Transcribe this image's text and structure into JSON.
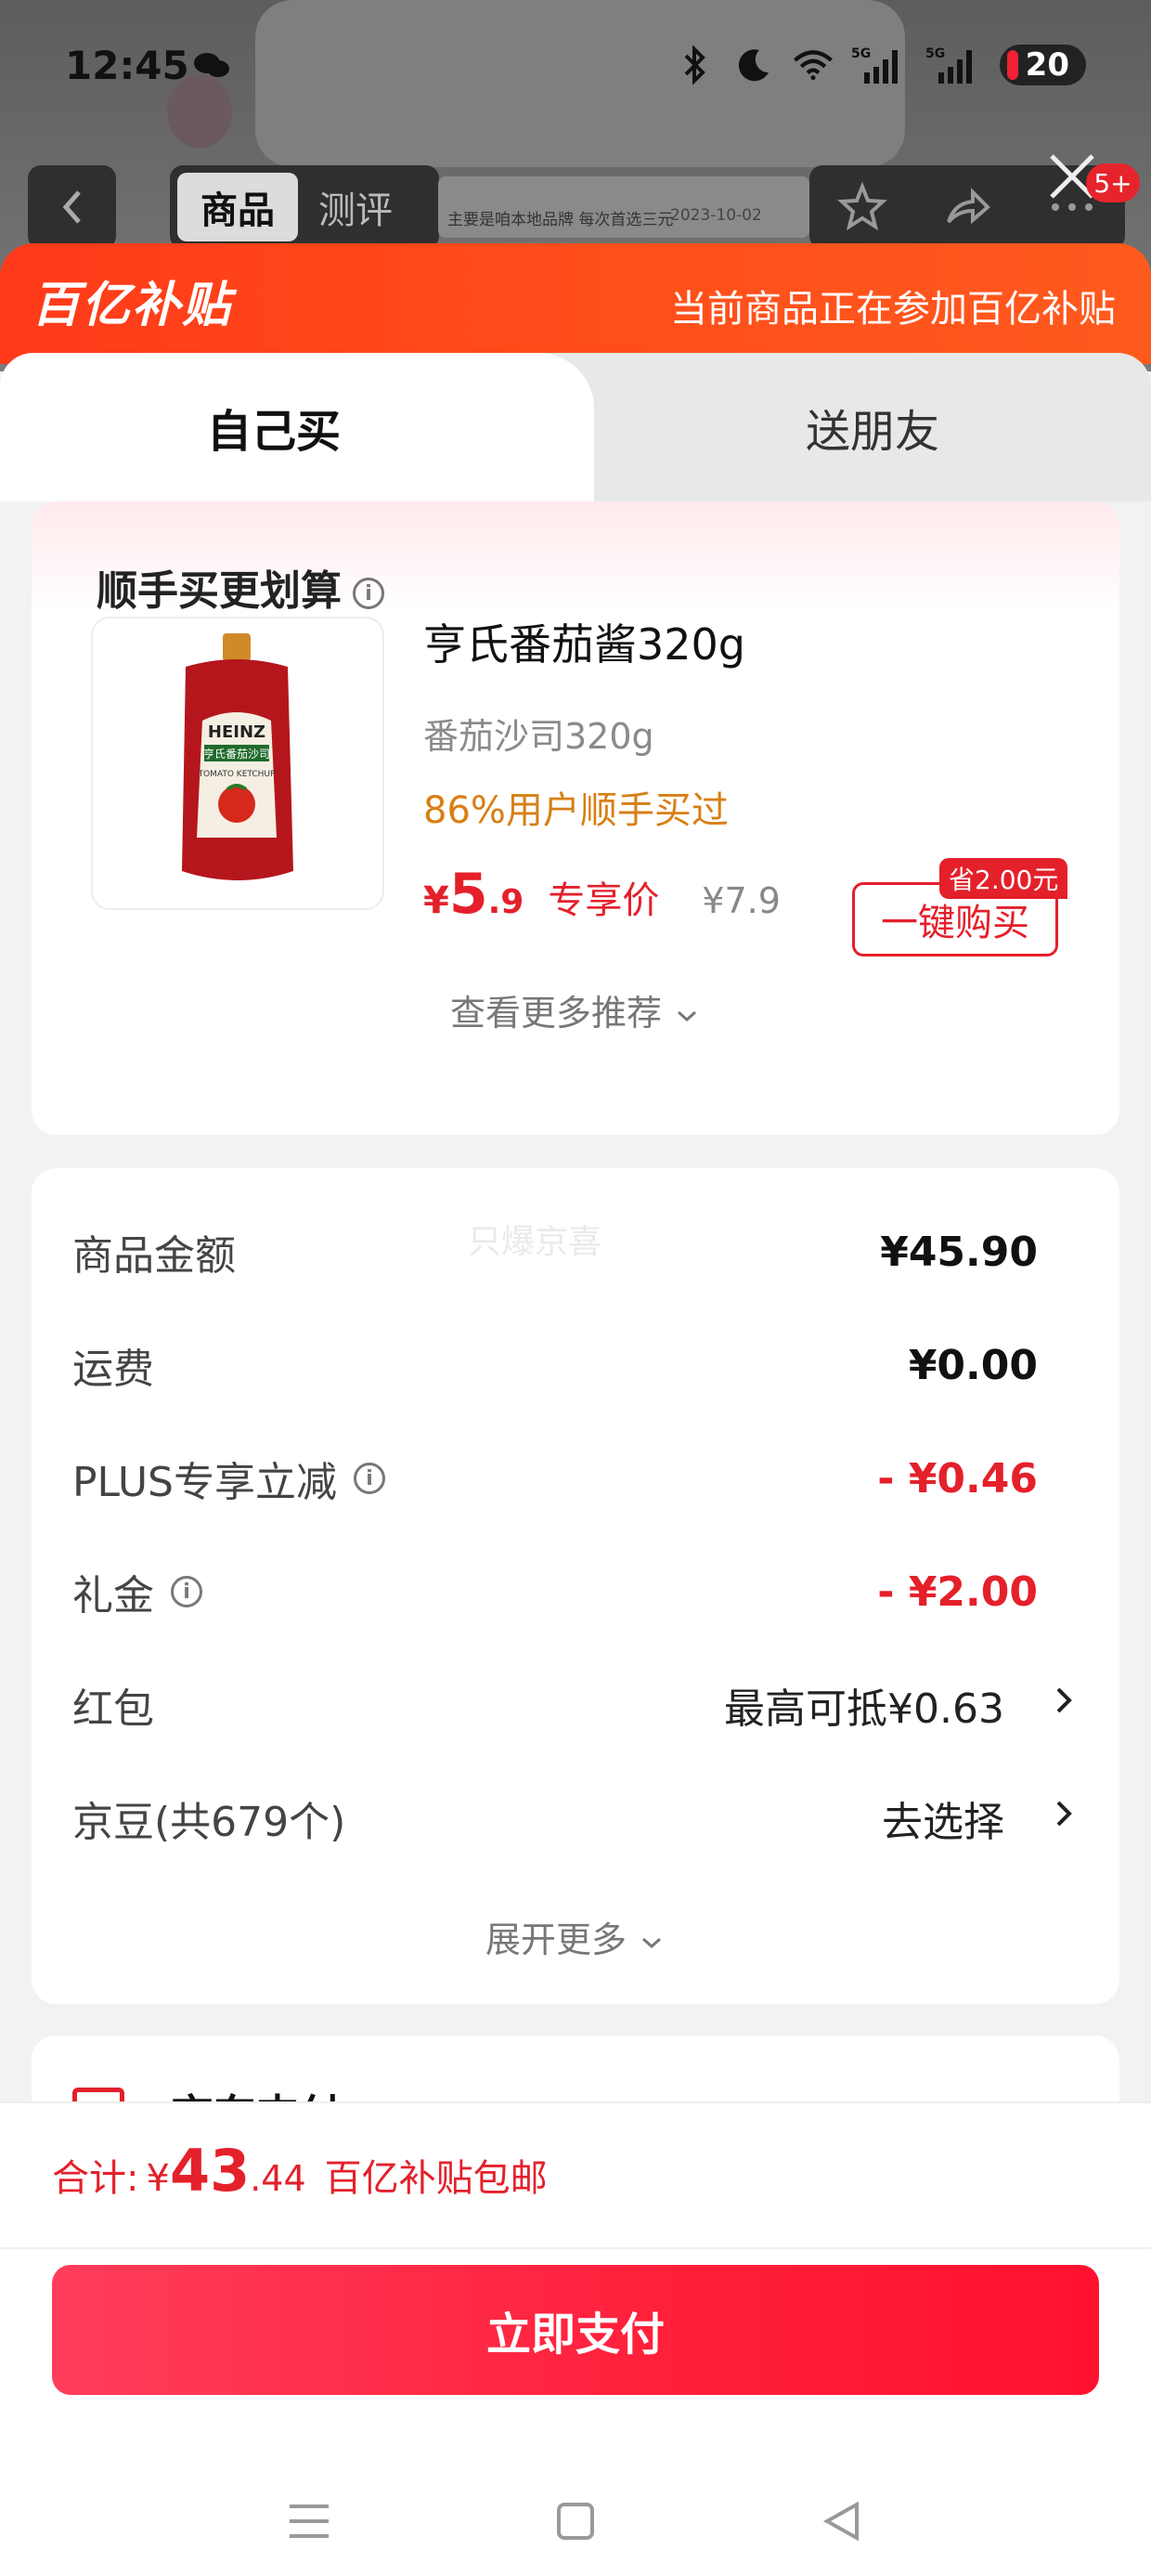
{
  "status_bar": {
    "time": "12:45",
    "battery": "20",
    "icons": [
      "wechat-icon",
      "bluetooth-icon",
      "moon-icon",
      "wifi-icon",
      "signal-5g-icon",
      "signal-5g-icon"
    ]
  },
  "background_nav": {
    "tabs": [
      "商品",
      "测评"
    ],
    "review_text": "主要是咱本地品牌 每次首选三元",
    "review_date": "2023-10-02",
    "badge": "5+"
  },
  "banner": {
    "logo": "百亿补贴",
    "note": "当前商品正在参加百亿补贴"
  },
  "tabs": {
    "self": "自己买",
    "gift": "送朋友"
  },
  "recommend": {
    "title": "顺手买更划算",
    "product": {
      "name": "亨氏番茄酱320g",
      "spec": "番茄沙司320g",
      "stat": "86%用户顺手买过",
      "price_symbol": "¥",
      "price_int": "5",
      "price_dec": ".9",
      "price_tag": "专享价",
      "original_price": "¥7.9",
      "save_tag": "省2.00元",
      "buy_label": "一键购买",
      "brand": "HEINZ",
      "pack_cn": "亨氏番茄沙司",
      "pack_en": "TOMATO KETCHUP"
    },
    "more": "查看更多推荐"
  },
  "summary": {
    "watermark": "只爆京喜",
    "rows": [
      {
        "label": "商品金额",
        "value": "¥45.90"
      },
      {
        "label": "运费",
        "value": "¥0.00"
      },
      {
        "label": "PLUS专享立减",
        "value": "- ¥0.46"
      },
      {
        "label": "礼金",
        "value": "- ¥2.00"
      },
      {
        "label": "红包",
        "value": "最高可抵¥0.63"
      },
      {
        "label": "京豆(共679个)",
        "value": "去选择"
      }
    ],
    "expand": "展开更多"
  },
  "payment_method": {
    "label": "京东支付"
  },
  "footer": {
    "total_label": "合计:",
    "total_symbol": "¥",
    "total_int": "43",
    "total_dec": ".44",
    "total_note": "百亿补贴包邮",
    "pay_button": "立即支付"
  },
  "colors": {
    "accent_red": "#e4202b",
    "banner_orange": "#ff4d1a",
    "stat_orange": "#d87f14"
  }
}
